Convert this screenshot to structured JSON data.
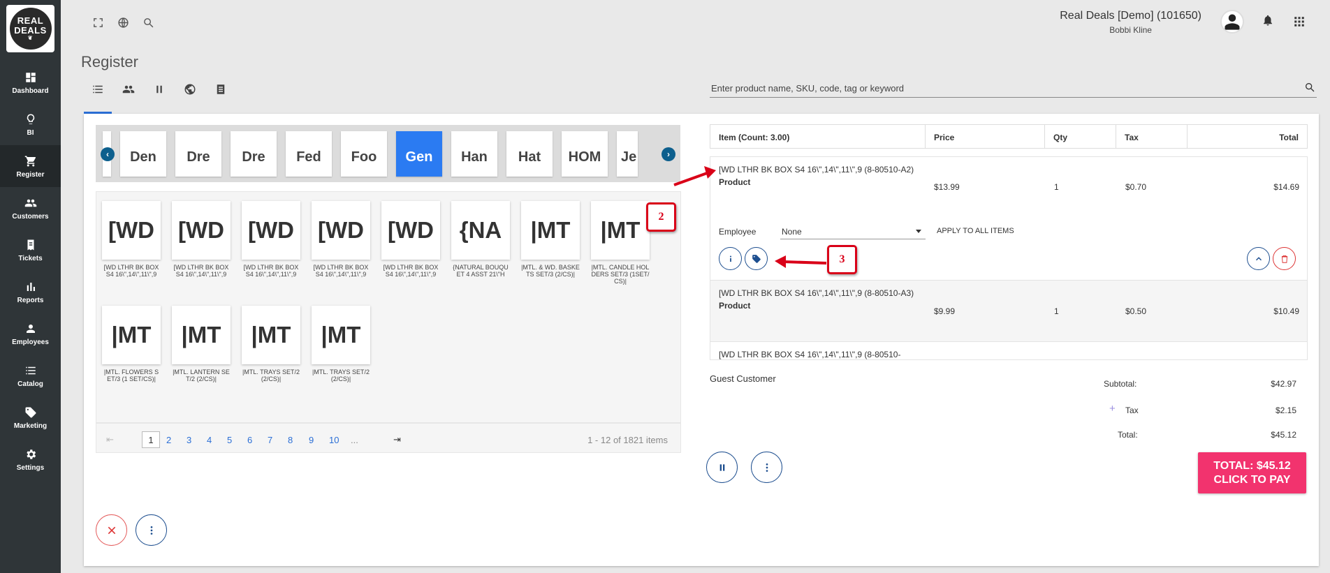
{
  "sidebar": {
    "logo_line1": "REAL",
    "logo_line2": "DEALS",
    "items": [
      {
        "label": "Dashboard",
        "icon": "dashboard-icon"
      },
      {
        "label": "BI",
        "icon": "lightbulb-icon"
      },
      {
        "label": "Register",
        "icon": "cart-icon",
        "active": true
      },
      {
        "label": "Customers",
        "icon": "people-icon"
      },
      {
        "label": "Tickets",
        "icon": "tickets-icon"
      },
      {
        "label": "Reports",
        "icon": "bar-chart-icon"
      },
      {
        "label": "Employees",
        "icon": "person-icon"
      },
      {
        "label": "Catalog",
        "icon": "list-icon"
      },
      {
        "label": "Marketing",
        "icon": "tag-icon"
      },
      {
        "label": "Settings",
        "icon": "gear-icon"
      }
    ]
  },
  "header": {
    "company": "Real Deals [Demo] (101650)",
    "user": "Bobbi Kline",
    "page_title": "Register"
  },
  "search": {
    "placeholder": "Enter product name, SKU, code, tag or keyword",
    "value": ""
  },
  "categories": {
    "items": [
      "",
      "Den",
      "Dre",
      "Dre",
      "Fed",
      "Foo",
      "Gen",
      "Han",
      "Hat",
      "HOM",
      "Je"
    ],
    "selected": "Gen"
  },
  "products": [
    {
      "thumb": "[WD",
      "name": "[WD LTHR BK BOX S4 16\\\",14\\\",11\\\",9"
    },
    {
      "thumb": "[WD",
      "name": "[WD LTHR BK BOX S4 16\\\",14\\\",11\\\",9"
    },
    {
      "thumb": "[WD",
      "name": "[WD LTHR BK BOX S4 16\\\",14\\\",11\\\",9"
    },
    {
      "thumb": "[WD",
      "name": "[WD LTHR BK BOX S4 16\\\",14\\\",11\\\",9"
    },
    {
      "thumb": "[WD",
      "name": "[WD LTHR BK BOX S4 16\\\",14\\\",11\\\",9"
    },
    {
      "thumb": "{NA",
      "name": "{NATURAL BOUQUET 4 ASST 21\\\"H"
    },
    {
      "thumb": "|MT",
      "name": "|MTL. & WD. BASKETS SET/3 (2/CS)|"
    },
    {
      "thumb": "|MT",
      "name": "|MTL. CANDLE HOLDERS SET/3 (1SET/CS)|"
    },
    {
      "thumb": "|MT",
      "name": "|MTL. FLOWERS SET/3 (1 SET/CS)|"
    },
    {
      "thumb": "|MT",
      "name": "|MTL. LANTERN SET/2 (2/CS)|"
    },
    {
      "thumb": "|MT",
      "name": "|MTL. TRAYS SET/2 (2/CS)|"
    },
    {
      "thumb": "|MT",
      "name": "|MTL. TRAYS SET/2 (2/CS)|"
    }
  ],
  "pager": {
    "pages": [
      "1",
      "2",
      "3",
      "4",
      "5",
      "6",
      "7",
      "8",
      "9",
      "10",
      "..."
    ],
    "current": "1",
    "summary": "1 - 12 of 1821 items"
  },
  "cart": {
    "headers": {
      "item": "Item (Count: 3.00)",
      "price": "Price",
      "qty": "Qty",
      "tax": "Tax",
      "total": "Total"
    },
    "lines": [
      {
        "desc": "[WD LTHR BK BOX S4 16\\\",14\\\",11\\\",9 (8-80510-A2)",
        "type": "Product",
        "price": "$13.99",
        "qty": "1",
        "tax": "$0.70",
        "total": "$14.69"
      },
      {
        "desc": "[WD LTHR BK BOX S4 16\\\",14\\\",11\\\",9 (8-80510-A3)",
        "type": "Product",
        "price": "$9.99",
        "qty": "1",
        "tax": "$0.50",
        "total": "$10.49"
      },
      {
        "desc": "[WD LTHR BK BOX S4 16\\\",14\\\",11\\\",9 (8-80510-",
        "type": "",
        "price": "",
        "qty": "",
        "tax": "",
        "total": ""
      }
    ],
    "employee_label": "Employee",
    "employee_value": "None",
    "apply_all": "APPLY TO ALL ITEMS",
    "customer": "Guest Customer",
    "subtotal_label": "Subtotal:",
    "subtotal": "$42.97",
    "tax_label": "Tax",
    "tax": "$2.15",
    "total_label": "Total:",
    "total": "$45.12",
    "pay_line1": "TOTAL: $45.12",
    "pay_line2": "CLICK TO PAY"
  },
  "annotations": {
    "marker_2": "2",
    "marker_3": "3"
  },
  "colors": {
    "accent": "#2b6fd6",
    "pay": "#f2336e",
    "marker": "#d90018",
    "sidebar": "#2f3538"
  }
}
